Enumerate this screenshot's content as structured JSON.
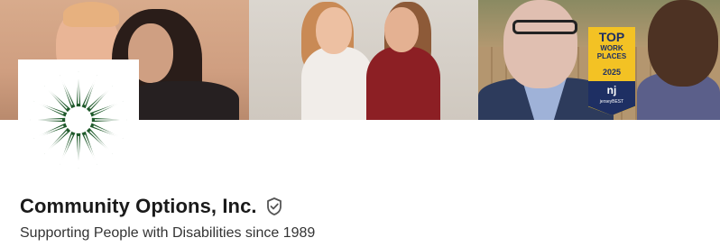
{
  "cover": {
    "award": {
      "top": "TOP",
      "line1": "WORK",
      "line2": "PLACES",
      "year": "2025",
      "nj": "nj",
      "sub": "jerseyBEST"
    }
  },
  "logo": {
    "icon": "starburst-logo",
    "color": "#1f5a2b"
  },
  "profile": {
    "name": "Community Options, Inc.",
    "verified_icon": "verified-shield-icon",
    "tagline": "Supporting People with Disabilities since 1989"
  }
}
